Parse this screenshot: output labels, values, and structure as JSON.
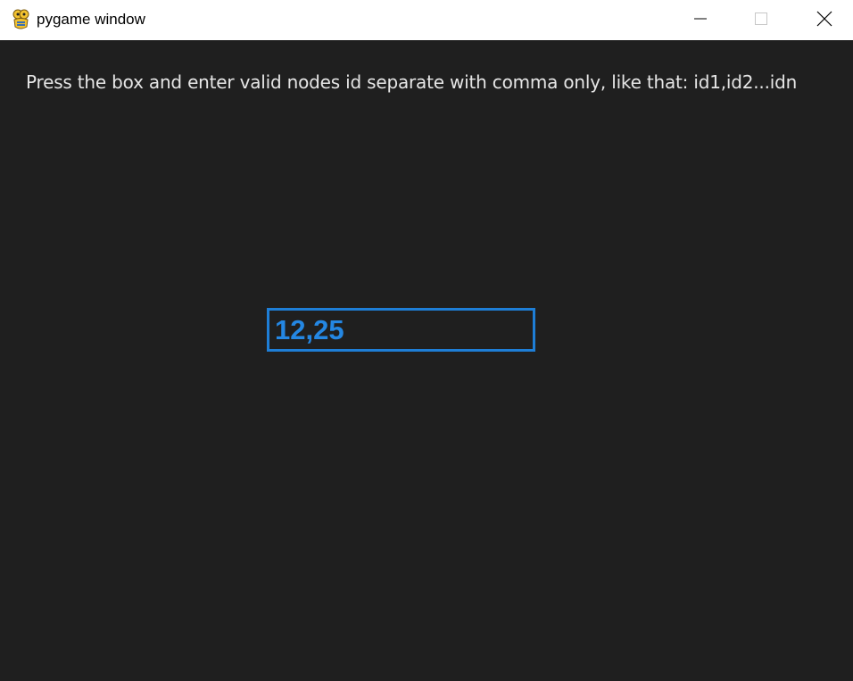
{
  "window": {
    "title": "pygame window",
    "icon": "pygame-snake-icon",
    "controls": {
      "minimize_icon": "minimize-icon",
      "maximize_icon": "maximize-icon",
      "close_icon": "close-icon"
    }
  },
  "main": {
    "instruction": "Press the box and enter valid nodes id separate with comma only, like that: id1,id2...idn",
    "input": {
      "value": "12,25"
    }
  },
  "colors": {
    "background": "#1f1f1f",
    "titlebar": "#ffffff",
    "instruction_text": "#e6e6e6",
    "input_border": "#1e7ed6",
    "input_text": "#2487e3"
  }
}
